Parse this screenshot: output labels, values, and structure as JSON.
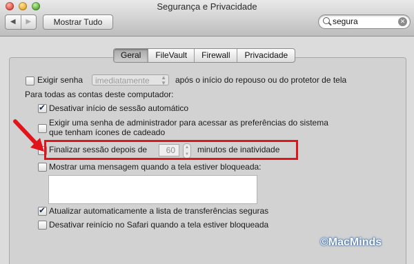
{
  "window": {
    "title": "Segurança e Privacidade"
  },
  "toolbar": {
    "back_glyph": "◀",
    "forward_glyph": "▶",
    "show_all_label": "Mostrar Tudo",
    "search_value": "segura",
    "search_clear_glyph": "✕"
  },
  "tabs": [
    {
      "label": "Geral",
      "active": true
    },
    {
      "label": "FileVault",
      "active": false
    },
    {
      "label": "Firewall",
      "active": false
    },
    {
      "label": "Privacidade",
      "active": false
    }
  ],
  "general": {
    "require_password_label": "Exigir senha",
    "require_password_checked": false,
    "require_password_delay": "imediatamente",
    "require_password_suffix": "após o início do repouso ou do protetor de tela",
    "all_accounts_heading": "Para todas as contas deste computador:",
    "disable_autologin_label": "Desativar início de sessão automático",
    "disable_autologin_checked": true,
    "admin_password_label_line1": "Exigir uma senha de administrador para acessar as preferências do sistema",
    "admin_password_label_line2": "que tenham ícones de cadeado",
    "admin_password_checked": false,
    "logout_after_label": "Finalizar sessão depois de",
    "logout_after_minutes": "60",
    "logout_after_suffix": "minutos de inatividade",
    "logout_after_checked": false,
    "show_message_label": "Mostrar uma mensagem quando a tela estiver bloqueada:",
    "show_message_checked": false,
    "message_text": "",
    "auto_update_label": "Atualizar automaticamente a lista de transferências seguras",
    "auto_update_checked": true,
    "disable_safari_restart_label": "Desativar reinício no Safari quando a tela estiver bloqueada",
    "disable_safari_restart_checked": false
  },
  "annotation": {
    "highlight_color": "#e1141c",
    "arrow_color": "#e1141c"
  },
  "watermark": {
    "text": "©MacMinds",
    "color": "#ffffff"
  }
}
